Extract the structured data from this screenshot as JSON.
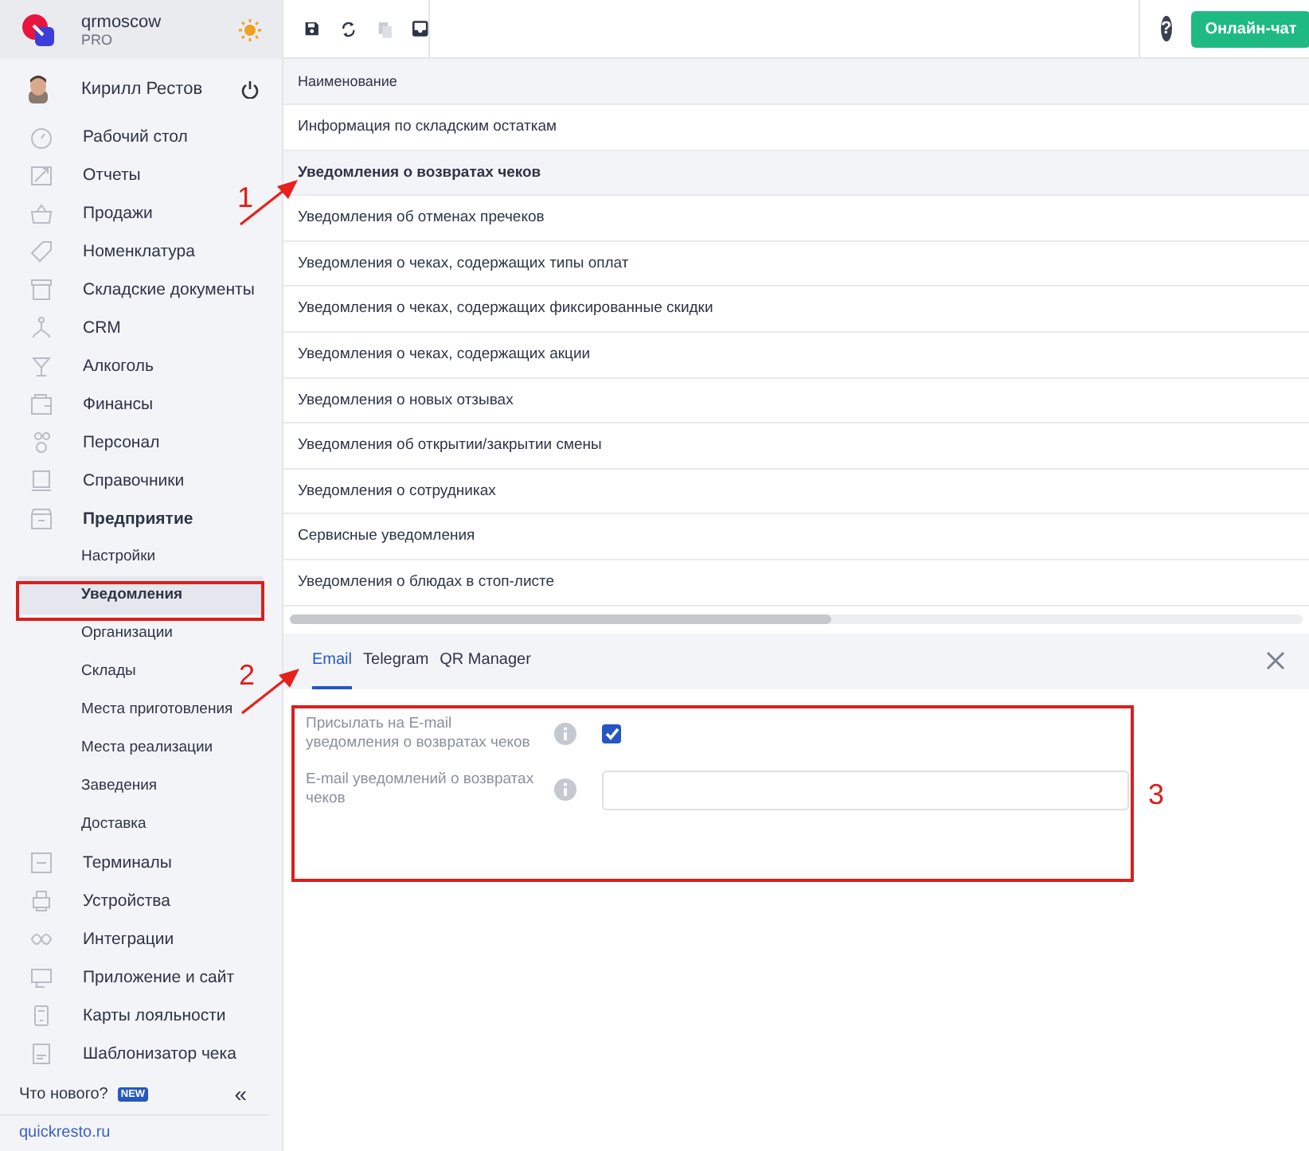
{
  "brand": {
    "name": "qrmoscow",
    "plan": "PRO"
  },
  "user": {
    "name": "Кирилл Рестов"
  },
  "sidebar": {
    "items": [
      {
        "label": "Рабочий стол",
        "expanded": false
      },
      {
        "label": "Отчеты",
        "expanded": false
      },
      {
        "label": "Продажи",
        "expanded": false
      },
      {
        "label": "Номенклатура",
        "expanded": false
      },
      {
        "label": "Складские документы",
        "expanded": false
      },
      {
        "label": "CRM",
        "expanded": false
      },
      {
        "label": "Алкоголь",
        "expanded": false
      },
      {
        "label": "Финансы",
        "expanded": false
      },
      {
        "label": "Персонал",
        "expanded": false
      },
      {
        "label": "Справочники",
        "expanded": false
      },
      {
        "label": "Предприятие",
        "expanded": true,
        "children": [
          {
            "label": "Настройки",
            "selected": false
          },
          {
            "label": "Уведомления",
            "selected": true
          },
          {
            "label": "Организации",
            "selected": false
          },
          {
            "label": "Склады",
            "selected": false
          },
          {
            "label": "Места приготовления",
            "selected": false
          },
          {
            "label": "Места реализации",
            "selected": false
          },
          {
            "label": "Заведения",
            "selected": false
          },
          {
            "label": "Доставка",
            "selected": false
          }
        ]
      },
      {
        "label": "Терминалы",
        "expanded": false
      },
      {
        "label": "Устройства",
        "expanded": false
      },
      {
        "label": "Интеграции",
        "expanded": false
      },
      {
        "label": "Приложение и сайт",
        "expanded": false
      },
      {
        "label": "Карты лояльности",
        "expanded": false
      },
      {
        "label": "Шаблонизатор чека",
        "expanded": false
      }
    ],
    "whats_new": "Что нового?",
    "new_badge": "NEW",
    "collapse": "«",
    "site_link": "quickresto.ru"
  },
  "toolbar": {
    "help": "?",
    "chat_button": "Онлайн-чат"
  },
  "table": {
    "columns": [
      "Наименование"
    ],
    "rows": [
      {
        "name": "Информация по складским остаткам",
        "selected": false
      },
      {
        "name": "Уведомления о возвратах чеков",
        "selected": true
      },
      {
        "name": "Уведомления об отменах пречеков",
        "selected": false
      },
      {
        "name": "Уведомления о чеках, содержащих типы оплат",
        "selected": false
      },
      {
        "name": "Уведомления о чеках, содержащих фиксированные скидки",
        "selected": false
      },
      {
        "name": "Уведомления о чеках, содержащих акции",
        "selected": false
      },
      {
        "name": "Уведомления о новых отзывах",
        "selected": false
      },
      {
        "name": "Уведомления об открытии/закрытии смены",
        "selected": false
      },
      {
        "name": "Уведомления о сотрудниках",
        "selected": false
      },
      {
        "name": "Сервисные уведомления",
        "selected": false
      },
      {
        "name": "Уведомления о блюдах в стоп-листе",
        "selected": false
      }
    ]
  },
  "detail": {
    "tabs": [
      {
        "label": "Email",
        "selected": true
      },
      {
        "label": "Telegram",
        "selected": false
      },
      {
        "label": "QR Manager",
        "selected": false
      }
    ],
    "fields": [
      {
        "kind": "checkbox",
        "label": "Присылать на E-mail уведомления о возвратах чеков",
        "checked": true
      },
      {
        "kind": "text",
        "label": "E-mail уведомлений о возвратах чеков"
      }
    ]
  },
  "annotations": [
    {
      "kind": "box"
    },
    {
      "kind": "box"
    },
    {
      "kind": "arrow",
      "label": "1"
    },
    {
      "kind": "arrow",
      "label": "2"
    },
    {
      "kind": "number",
      "label": "3"
    }
  ]
}
